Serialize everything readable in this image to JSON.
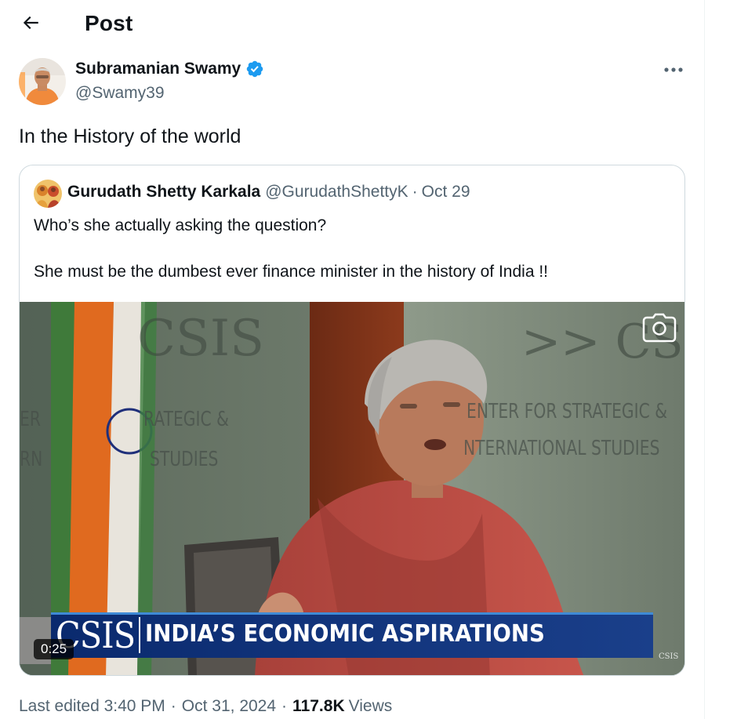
{
  "header": {
    "title": "Post",
    "back_icon": "arrow-left-icon"
  },
  "post": {
    "author": {
      "name": "Subramanian Swamy",
      "handle": "@Swamy39",
      "verified": true
    },
    "text": "In the History of the world",
    "more_icon": "more-horizontal-icon",
    "quoted": {
      "author_name": "Gurudath Shetty Karkala",
      "author_handle": "@GurudathShettyK",
      "separator": "·",
      "date": "Oct 29",
      "line1": "Who’s she actually asking the question?",
      "line2": "She must be the dumbest ever finance minister in the history of India !!",
      "video": {
        "duration": "0:25",
        "banner_logo": "CSIS",
        "banner_text": "INDIA’S ECONOMIC ASPIRATIONS",
        "corner_logo": "CSIS",
        "bg_left_logo": "CSIS",
        "bg_right_logo": ">> CSIS",
        "bg_left_line1": "RATEGIC &",
        "bg_left_line2": "STUDIES",
        "bg_far_left1": "ER",
        "bg_far_left2": "RN",
        "bg_right_line1": "ENTER FOR STRATEGIC &",
        "bg_right_line2": "NTERNATIONAL STUDIES",
        "camera_icon": "camera-icon"
      }
    },
    "footer": {
      "edited": "Last edited 3:40 PM",
      "dot1": "·",
      "date": "Oct 31, 2024",
      "dot2": "·",
      "views_count": "117.8K",
      "views_label": "Views"
    }
  },
  "colors": {
    "text_primary": "#0f1419",
    "text_secondary": "#536471",
    "verified_blue": "#1d9bf0",
    "border": "#cfd9de"
  }
}
